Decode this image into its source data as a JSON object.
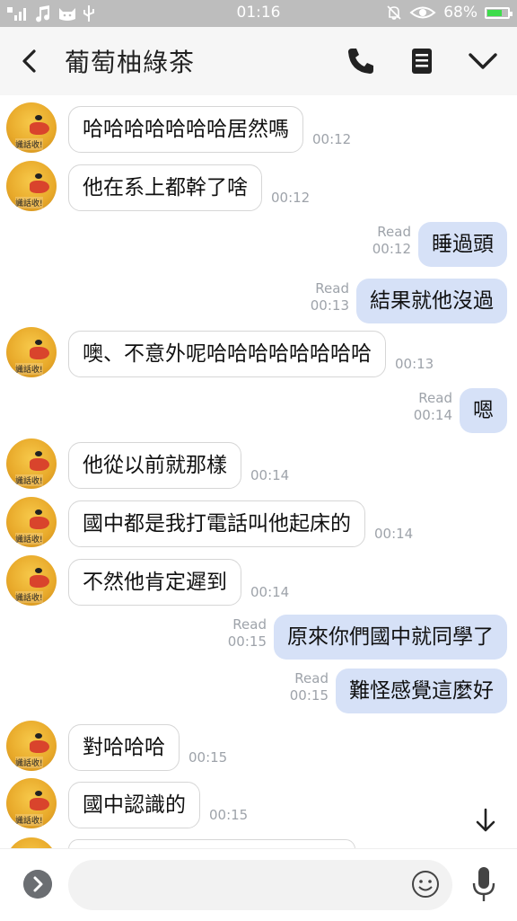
{
  "status_bar": {
    "time": "01:16",
    "battery": "68%",
    "battery_level": 0.68
  },
  "header": {
    "title": "葡萄柚綠茶"
  },
  "avatar_label": "識話收!",
  "messages": [
    {
      "side": "in",
      "text": "哈哈哈哈哈哈哈居然嗎",
      "time": "00:12"
    },
    {
      "side": "in",
      "text": "他在系上都幹了啥",
      "time": "00:12"
    },
    {
      "side": "out",
      "text": "睡過頭",
      "read": "Read",
      "time": "00:12"
    },
    {
      "side": "out",
      "text": "結果就他沒過",
      "read": "Read",
      "time": "00:13"
    },
    {
      "side": "in",
      "text": "噢、不意外呢哈哈哈哈哈哈哈哈",
      "time": "00:13"
    },
    {
      "side": "out",
      "text": "嗯",
      "read": "Read",
      "time": "00:14"
    },
    {
      "side": "in",
      "text": "他從以前就那樣",
      "time": "00:14"
    },
    {
      "side": "in",
      "text": "國中都是我打電話叫他起床的",
      "time": "00:14"
    },
    {
      "side": "in",
      "text": "不然他肯定遲到",
      "time": "00:14"
    },
    {
      "side": "out",
      "text": "原來你們國中就同學了",
      "read": "Read",
      "time": "00:15"
    },
    {
      "side": "out",
      "text": "難怪感覺這麼好",
      "read": "Read",
      "time": "00:15"
    },
    {
      "side": "in",
      "text": "對哈哈哈",
      "time": "00:15"
    },
    {
      "side": "in",
      "text": "國中認識的",
      "time": "00:15"
    }
  ],
  "icons": {
    "back": "chevron-left-icon",
    "call": "phone-icon",
    "notes": "notes-icon",
    "menu": "chevron-down-icon",
    "add": "chevron-right-icon",
    "emoji": "smiley-icon",
    "voice": "microphone-icon",
    "scroll": "arrow-down-icon"
  },
  "colors": {
    "outgoing_bubble": "#d6e1f7",
    "incoming_bubble": "#ffffff",
    "header_bg": "#f6f6f6",
    "status_bar": "#bdbdbd"
  }
}
